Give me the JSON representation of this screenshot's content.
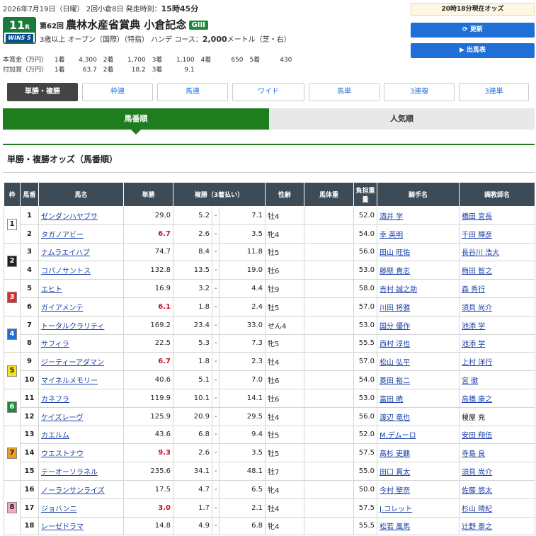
{
  "header": {
    "date": "2026年7月19日（日曜）",
    "meeting": "2回小倉8日",
    "start_label": "発走時刻：",
    "start_time": "15時45分",
    "race_no": "11",
    "race_no_suffix": "R",
    "win5_label": "WIN5 5",
    "edition": "第62回",
    "race_name": "農林水産省賞典 小倉記念",
    "grade": "GIII",
    "age_cond": "3歳以上",
    "class_cond": "オープン（国際）（特指）",
    "weight_cond": "ハンデ",
    "course_label": "コース：",
    "distance": "2,000",
    "distance_unit": "メートル（芝・右）"
  },
  "prize": {
    "main_label": "本賞金（万円）",
    "main": [
      {
        "k": "1着",
        "v": "4,300"
      },
      {
        "k": "2着",
        "v": "1,700"
      },
      {
        "k": "3着",
        "v": "1,100"
      },
      {
        "k": "4着",
        "v": "650"
      },
      {
        "k": "5着",
        "v": "430"
      }
    ],
    "add_label": "付加賞（万円）",
    "add": [
      {
        "k": "1着",
        "v": "63.7"
      },
      {
        "k": "2着",
        "v": "18.2"
      },
      {
        "k": "3着",
        "v": "9.1"
      }
    ]
  },
  "side": {
    "odds_time": "20時18分現在オッズ",
    "refresh_label": "更新",
    "entries_label": "出馬表"
  },
  "bet_tabs": [
    "単勝・複勝",
    "枠連",
    "馬連",
    "ワイド",
    "馬単",
    "3連複",
    "3連単"
  ],
  "sub_tabs": {
    "left": "馬番順",
    "right": "人気順"
  },
  "section_title": "単勝・複勝オッズ（馬番順）",
  "table": {
    "headers": {
      "waku": "枠",
      "umaban": "馬番",
      "horse": "馬名",
      "tan": "単勝",
      "fuku": "複勝（3着払い）",
      "sex": "性齢",
      "bw": "馬体重",
      "wt": "負担重量",
      "jockey": "騎手名",
      "trainer": "調教師名"
    },
    "waku_colors": {
      "1": {
        "bg": "#ffffff",
        "fg": "#222222"
      },
      "2": {
        "bg": "#222222",
        "fg": "#ffffff"
      },
      "3": {
        "bg": "#e02b2b",
        "fg": "#ffffff"
      },
      "4": {
        "bg": "#1f6fd6",
        "fg": "#ffffff"
      },
      "5": {
        "bg": "#f7e21b",
        "fg": "#222222"
      },
      "6": {
        "bg": "#1e8c3c",
        "fg": "#ffffff"
      },
      "7": {
        "bg": "#f39a1e",
        "fg": "#222222"
      },
      "8": {
        "bg": "#f7a6c0",
        "fg": "#222222"
      }
    },
    "rows": [
      {
        "waku": "1",
        "num": "1",
        "horse": "ゼンダンハヤブサ",
        "tan": "29.0",
        "hot": false,
        "fmin": "5.2",
        "fmax": "7.1",
        "sex": "牡4",
        "wt": "52.0",
        "jockey": "酒井 学",
        "trainer": "橋田 宜長",
        "tlink": true
      },
      {
        "waku": "1",
        "num": "2",
        "horse": "タガノアビー",
        "tan": "6.7",
        "hot": true,
        "fmin": "2.6",
        "fmax": "3.5",
        "sex": "牝4",
        "wt": "54.0",
        "jockey": "幸 英明",
        "trainer": "千田 輝彦",
        "tlink": true
      },
      {
        "waku": "2",
        "num": "3",
        "horse": "ナムラエイハブ",
        "tan": "74.7",
        "hot": false,
        "fmin": "8.4",
        "fmax": "11.8",
        "sex": "牡5",
        "wt": "56.0",
        "jockey": "田山 旺佑",
        "trainer": "長谷川 浩大",
        "tlink": true
      },
      {
        "waku": "2",
        "num": "4",
        "horse": "コパノサントス",
        "tan": "132.8",
        "hot": false,
        "fmin": "13.5",
        "fmax": "19.0",
        "sex": "牡6",
        "wt": "53.0",
        "jockey": "藤懸 貴志",
        "trainer": "梅田 智之",
        "tlink": true
      },
      {
        "waku": "3",
        "num": "5",
        "horse": "エヒト",
        "tan": "16.9",
        "hot": false,
        "fmin": "3.2",
        "fmax": "4.4",
        "sex": "牡9",
        "wt": "58.0",
        "jockey": "吉村 誠之助",
        "trainer": "森 秀行",
        "tlink": true
      },
      {
        "waku": "3",
        "num": "6",
        "horse": "ガイアメンテ",
        "tan": "6.1",
        "hot": true,
        "fmin": "1.8",
        "fmax": "2.4",
        "sex": "牡5",
        "wt": "57.0",
        "jockey": "川田 将雅",
        "trainer": "須貝 尚介",
        "tlink": true
      },
      {
        "waku": "4",
        "num": "7",
        "horse": "トータルクラリティ",
        "tan": "169.2",
        "hot": false,
        "fmin": "23.4",
        "fmax": "33.0",
        "sex": "せん4",
        "wt": "53.0",
        "jockey": "国分 優作",
        "trainer": "池添 学",
        "tlink": true
      },
      {
        "waku": "4",
        "num": "8",
        "horse": "サフィラ",
        "tan": "22.5",
        "hot": false,
        "fmin": "5.3",
        "fmax": "7.3",
        "sex": "牝5",
        "wt": "55.5",
        "jockey": "西村 淳也",
        "trainer": "池添 学",
        "tlink": true
      },
      {
        "waku": "5",
        "num": "9",
        "horse": "ジーティーアダマン",
        "tan": "6.7",
        "hot": true,
        "fmin": "1.8",
        "fmax": "2.3",
        "sex": "牡4",
        "wt": "57.0",
        "jockey": "松山 弘平",
        "trainer": "上村 洋行",
        "tlink": true
      },
      {
        "waku": "5",
        "num": "10",
        "horse": "マイネルメモリー",
        "tan": "40.6",
        "hot": false,
        "fmin": "5.1",
        "fmax": "7.0",
        "sex": "牡6",
        "wt": "54.0",
        "jockey": "菱田 裕二",
        "trainer": "宮 徹",
        "tlink": true
      },
      {
        "waku": "6",
        "num": "11",
        "horse": "カネフラ",
        "tan": "119.9",
        "hot": false,
        "fmin": "10.1",
        "fmax": "14.1",
        "sex": "牡6",
        "wt": "53.0",
        "jockey": "富田 暁",
        "trainer": "高橋 康之",
        "tlink": true
      },
      {
        "waku": "6",
        "num": "12",
        "horse": "ケイズレーヴ",
        "tan": "125.9",
        "hot": false,
        "fmin": "20.9",
        "fmax": "29.5",
        "sex": "牡4",
        "wt": "56.0",
        "jockey": "渡辺 竜也",
        "trainer": "榎屋 充",
        "tlink": false
      },
      {
        "waku": "7",
        "num": "13",
        "horse": "カエルム",
        "tan": "43.6",
        "hot": false,
        "fmin": "6.8",
        "fmax": "9.4",
        "sex": "牡5",
        "wt": "52.0",
        "jockey": "M.デムーロ",
        "trainer": "安田 翔伍",
        "tlink": true
      },
      {
        "waku": "7",
        "num": "14",
        "horse": "ウエストナウ",
        "tan": "9.3",
        "hot": true,
        "fmin": "2.6",
        "fmax": "3.5",
        "sex": "牡5",
        "wt": "57.5",
        "jockey": "高杉 吏麒",
        "trainer": "寺島 良",
        "tlink": true
      },
      {
        "waku": "7",
        "num": "15",
        "horse": "テーオーソラネル",
        "tan": "235.6",
        "hot": false,
        "fmin": "34.1",
        "fmax": "48.1",
        "sex": "牡7",
        "wt": "55.0",
        "jockey": "田口 貫太",
        "trainer": "須貝 尚介",
        "tlink": true
      },
      {
        "waku": "8",
        "num": "16",
        "horse": "ノーランサンライズ",
        "tan": "17.5",
        "hot": false,
        "fmin": "4.7",
        "fmax": "6.5",
        "sex": "牝4",
        "wt": "50.0",
        "jockey": "今村 聖奈",
        "trainer": "佐藤 悠太",
        "tlink": true
      },
      {
        "waku": "8",
        "num": "17",
        "horse": "ジョバンニ",
        "tan": "3.0",
        "hot": true,
        "fmin": "1.7",
        "fmax": "2.1",
        "sex": "牡4",
        "wt": "57.5",
        "jockey": "J.コレット",
        "trainer": "杉山 晴紀",
        "tlink": true
      },
      {
        "waku": "8",
        "num": "18",
        "horse": "レーゼドラマ",
        "tan": "14.8",
        "hot": false,
        "fmin": "4.9",
        "fmax": "6.8",
        "sex": "牝4",
        "wt": "55.5",
        "jockey": "松若 風馬",
        "trainer": "辻野 泰之",
        "tlink": true
      }
    ]
  }
}
